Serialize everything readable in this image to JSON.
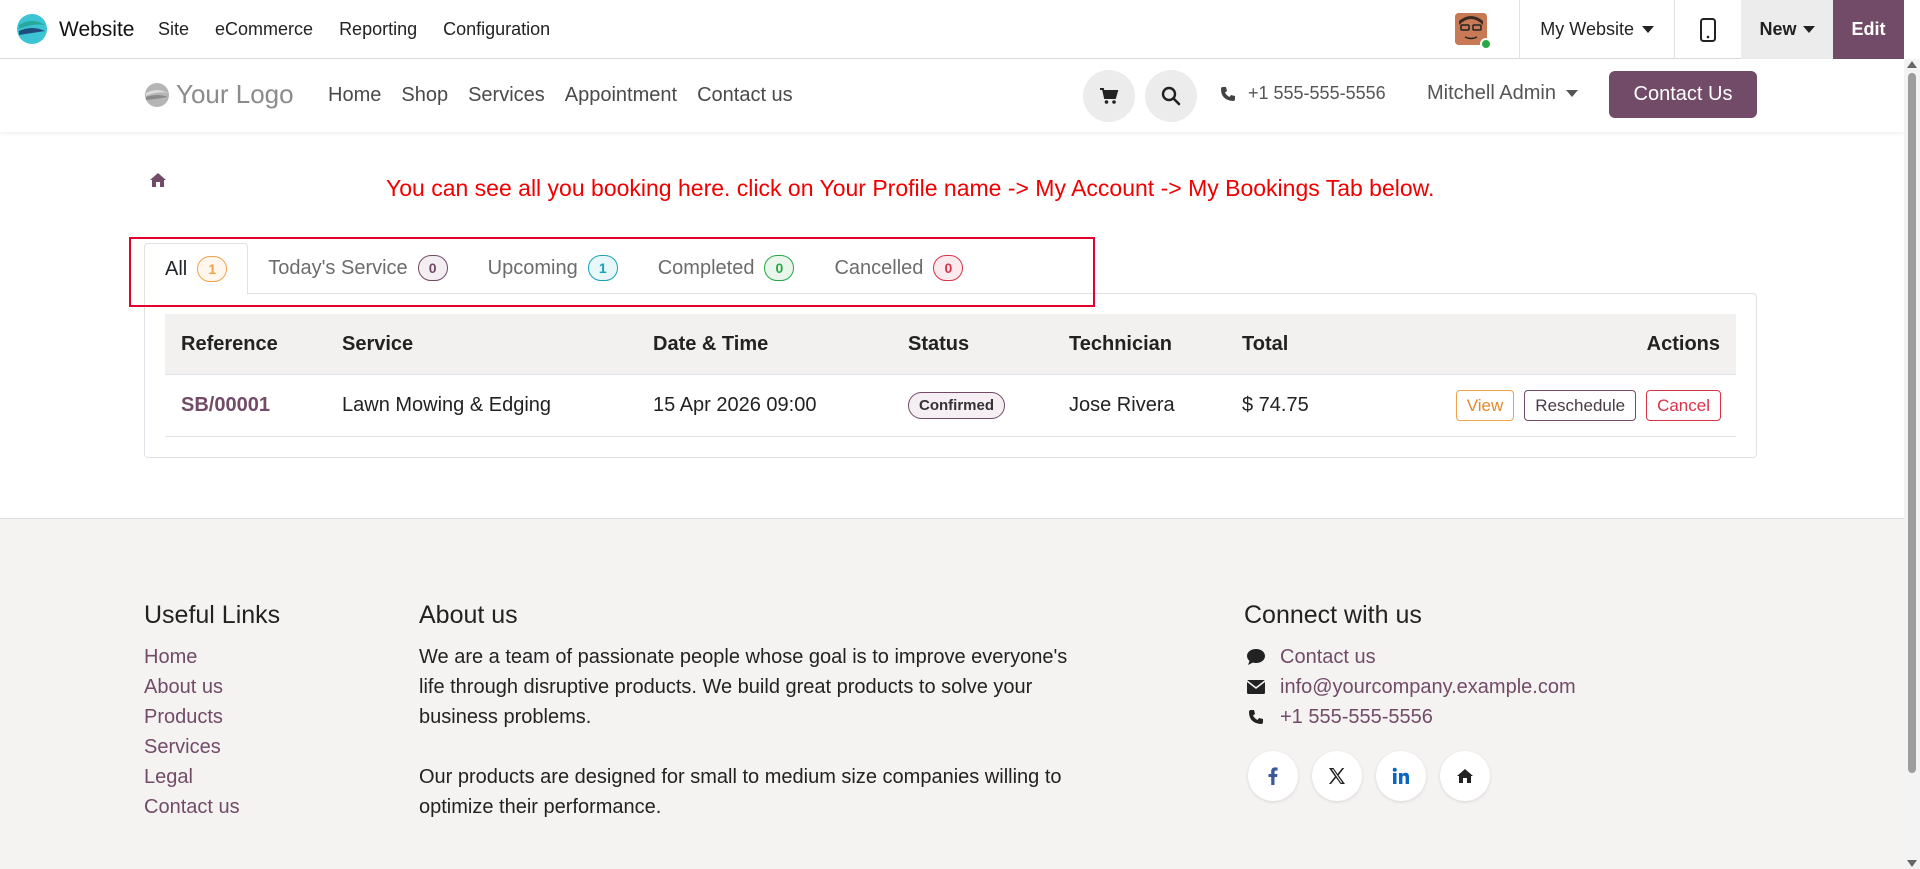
{
  "odoo_bar": {
    "app_name": "Website",
    "menu": [
      "Site",
      "eCommerce",
      "Reporting",
      "Configuration"
    ],
    "website_selector": "My Website",
    "new_label": "New",
    "edit_label": "Edit",
    "accent": "#714b67"
  },
  "header": {
    "logo_text": "Your Logo",
    "nav": [
      "Home",
      "Shop",
      "Services",
      "Appointment",
      "Contact us"
    ],
    "phone": "+1 555-555-5556",
    "user": "Mitchell Admin",
    "contact_button": "Contact Us"
  },
  "notice": "You can see all you booking here. click on Your Profile name -> My Account -> My Bookings Tab below.",
  "tabs": [
    {
      "label": "All",
      "count": "1",
      "color": "#f0a24b",
      "bg": "#fff7ee"
    },
    {
      "label": "Today's Service",
      "count": "0",
      "color": "#714b67",
      "bg": "#f3eef2"
    },
    {
      "label": "Upcoming",
      "count": "1",
      "color": "#17a2b8",
      "bg": "#e8f7fa"
    },
    {
      "label": "Completed",
      "count": "0",
      "color": "#28a745",
      "bg": "#eaf6ec"
    },
    {
      "label": "Cancelled",
      "count": "0",
      "color": "#d9334a",
      "bg": "#fcebee"
    }
  ],
  "table": {
    "headers": {
      "reference": "Reference",
      "service": "Service",
      "datetime": "Date & Time",
      "status": "Status",
      "technician": "Technician",
      "total": "Total",
      "actions": "Actions"
    },
    "rows": [
      {
        "reference": "SB/00001",
        "service": "Lawn Mowing & Edging",
        "datetime": "15 Apr 2026 09:00",
        "status": "Confirmed",
        "technician": "Jose Rivera",
        "total": "$ 74.75",
        "actions": {
          "view": "View",
          "reschedule": "Reschedule",
          "cancel": "Cancel"
        }
      }
    ]
  },
  "footer": {
    "useful_links_title": "Useful Links",
    "useful_links": [
      "Home",
      "About us",
      "Products",
      "Services",
      "Legal",
      "Contact us"
    ],
    "about_title": "About us",
    "about_p1": "We are a team of passionate people whose goal is to improve everyone's life through disruptive products. We build great products to solve your business problems.",
    "about_p2": "Our products are designed for small to medium size companies willing to optimize their performance.",
    "connect_title": "Connect with us",
    "connect_contact": "Contact us",
    "connect_email": "info@yourcompany.example.com",
    "connect_phone": "+1 555-555-5556",
    "social_icons": [
      "facebook-icon",
      "x-twitter-icon",
      "linkedin-icon",
      "home-icon"
    ]
  }
}
